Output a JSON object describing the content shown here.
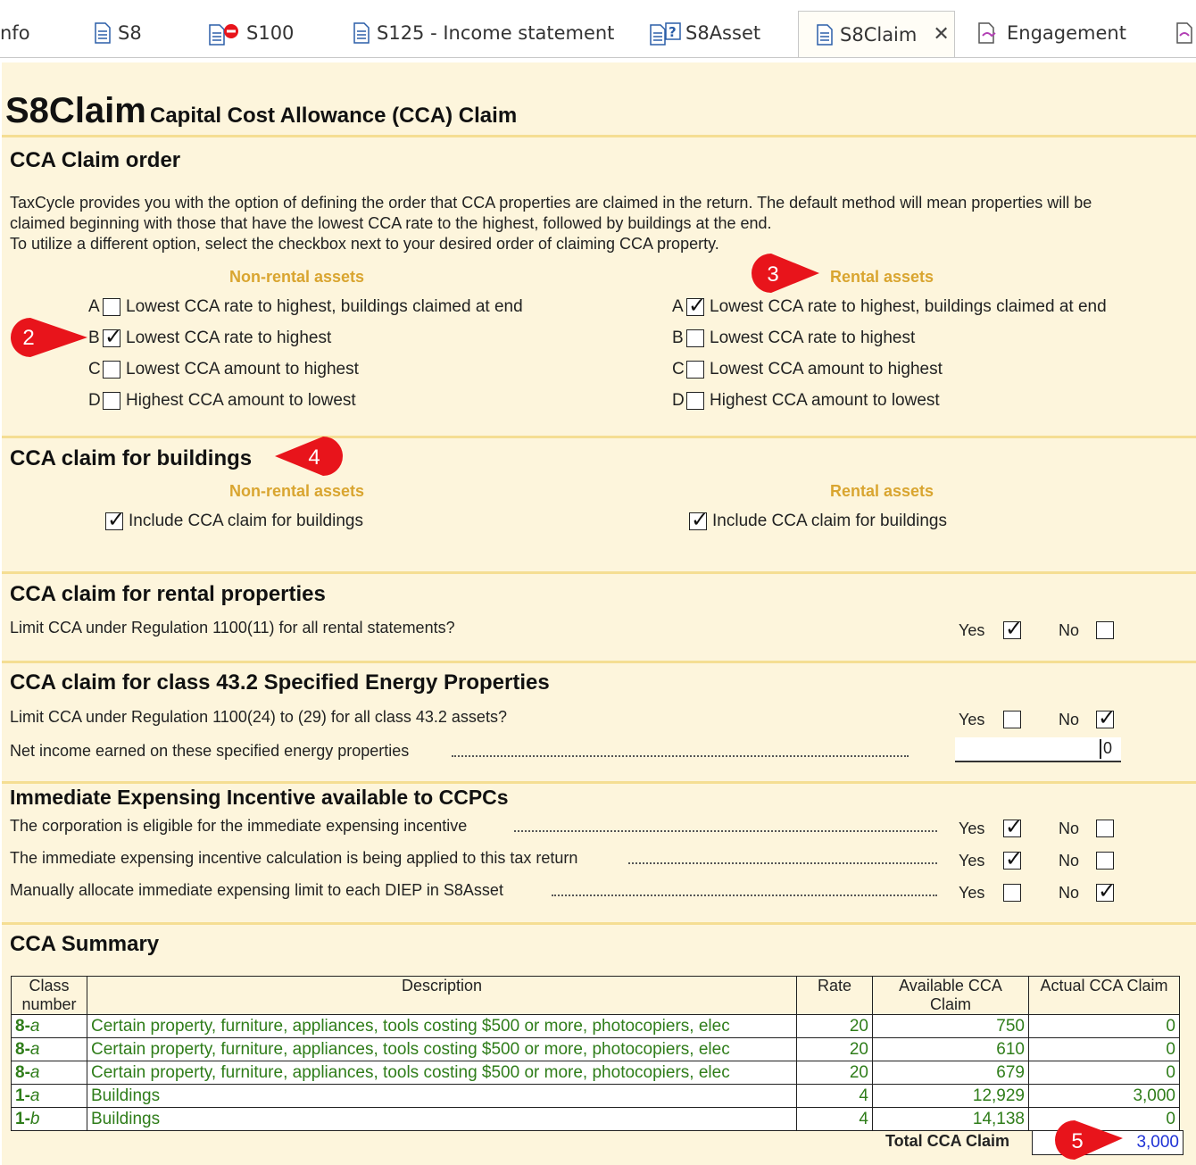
{
  "tabs": [
    {
      "label": "nfo"
    },
    {
      "label": "S8"
    },
    {
      "label": "S100"
    },
    {
      "label": "S125 - Income statement"
    },
    {
      "label": "S8Asset"
    },
    {
      "label": "S8Claim"
    },
    {
      "label": "Engagement"
    }
  ],
  "header": {
    "title": "S8Claim",
    "subtitle": "Capital Cost Allowance (CCA) Claim"
  },
  "claim_order": {
    "heading": "CCA Claim order",
    "para1": "TaxCycle provides you with the option of defining the order that CCA properties are claimed in the return. The default method will mean properties will be",
    "para2": "claimed beginning with those that have the lowest CCA rate to the highest, followed by buildings at the end.",
    "para3": "To utilize a different option, select the checkbox next to your desired order of claiming CCA property.",
    "nonrental_heading": "Non-rental assets",
    "rental_heading": "Rental assets",
    "options": [
      {
        "letter": "A",
        "label": "Lowest CCA rate to highest, buildings claimed at end",
        "nonrental_checked": false,
        "rental_checked": true
      },
      {
        "letter": "B",
        "label": "Lowest CCA rate to highest",
        "nonrental_checked": true,
        "rental_checked": false
      },
      {
        "letter": "C",
        "label": "Lowest CCA amount to highest",
        "nonrental_checked": false,
        "rental_checked": false
      },
      {
        "letter": "D",
        "label": "Highest CCA amount to lowest",
        "nonrental_checked": false,
        "rental_checked": false
      }
    ]
  },
  "buildings": {
    "heading": "CCA claim for buildings",
    "nonrental_heading": "Non-rental assets",
    "rental_heading": "Rental assets",
    "nonrental_label": "Include CCA claim for buildings",
    "rental_label": "Include CCA claim for buildings",
    "tick": "✓"
  },
  "rental": {
    "heading": "CCA claim for rental properties",
    "question": "Limit CCA under Regulation 1100(11) for all rental statements?",
    "yes": "Yes",
    "no": "No"
  },
  "energy": {
    "heading": "CCA claim for class 43.2 Specified Energy Properties",
    "question": "Limit CCA under Regulation 1100(24) to (29) for all class 43.2 assets?",
    "net_income_label": "Net income earned on these specified energy properties",
    "net_income_value": "0",
    "yes": "Yes",
    "no": "No"
  },
  "incentive": {
    "heading": "Immediate Expensing Incentive available to CCPCs",
    "q1": "The corporation is eligible for the immediate expensing incentive",
    "q2": "The immediate expensing incentive calculation is being applied to this tax return",
    "q3": "Manually allocate immediate expensing limit to each DIEP in S8Asset",
    "yes": "Yes",
    "no": "No"
  },
  "summary": {
    "heading": "CCA Summary",
    "col_class_1": "Class",
    "col_class_2": "number",
    "col_desc": "Description",
    "col_rate": "Rate",
    "col_avail_1": "Available CCA",
    "col_avail_2": "Claim",
    "col_actual": "Actual CCA Claim",
    "rows": [
      {
        "cls": "8",
        "sub": "a",
        "desc": "Certain property, furniture, appliances, tools costing $500 or more, photocopiers, elec",
        "rate": "20",
        "avail": "750",
        "actual": "0"
      },
      {
        "cls": "8",
        "sub": "a",
        "desc": "Certain property, furniture, appliances, tools costing $500 or more, photocopiers, elec",
        "rate": "20",
        "avail": "610",
        "actual": "0"
      },
      {
        "cls": "8",
        "sub": "a",
        "desc": "Certain property, furniture, appliances, tools costing $500 or more, photocopiers, elec",
        "rate": "20",
        "avail": "679",
        "actual": "0"
      },
      {
        "cls": "1",
        "sub": "a",
        "desc": "Buildings",
        "rate": "4",
        "avail": "12,929",
        "actual": "3,000"
      },
      {
        "cls": "1",
        "sub": "b",
        "desc": "Buildings",
        "rate": "4",
        "avail": "14,138",
        "actual": "0"
      }
    ],
    "total_label": "Total CCA Claim",
    "total_value": "3,000"
  },
  "callouts": [
    "2",
    "3",
    "4",
    "5"
  ],
  "colors": {
    "accent": "#d9a530",
    "panel": "#fdf5dc",
    "green": "#2f7d1a",
    "blue": "#1f32d6",
    "callout": "#e8141b"
  }
}
